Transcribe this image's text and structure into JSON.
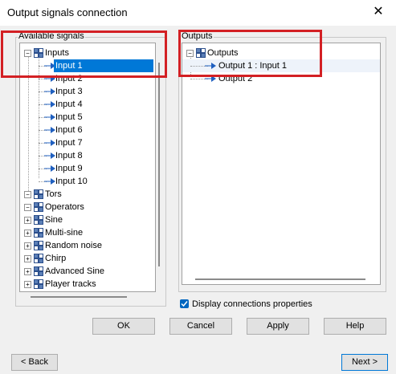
{
  "window": {
    "title": "Output signals connection"
  },
  "available": {
    "label": "Available signals",
    "inputs_label": "Inputs",
    "inputs": [
      "Input 1",
      "Input 2",
      "Input 3",
      "Input 4",
      "Input 5",
      "Input 6",
      "Input 7",
      "Input 8",
      "Input 9",
      "Input 10"
    ],
    "groups": [
      "Tors",
      "Operators",
      "Sine",
      "Multi-sine",
      "Random noise",
      "Chirp",
      "Advanced Sine",
      "Player tracks"
    ]
  },
  "outputs": {
    "label": "Outputs",
    "root_label": "Outputs",
    "items": [
      "Output 1 : Input 1",
      "Output 2"
    ]
  },
  "options": {
    "display_connections": "Display connections properties",
    "display_connections_checked": true
  },
  "buttons": {
    "ok": "OK",
    "cancel": "Cancel",
    "apply": "Apply",
    "help": "Help",
    "back": "< Back",
    "next": "Next >"
  },
  "colors": {
    "selection": "#0078d7",
    "highlight_box": "#d32024",
    "checkbox": "#0067c0"
  }
}
